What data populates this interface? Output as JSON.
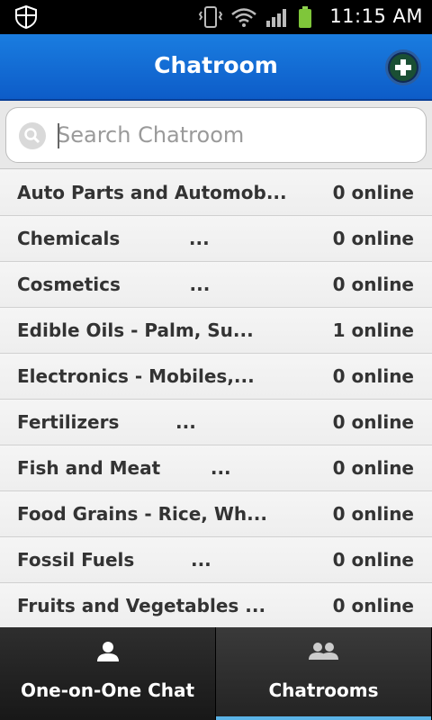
{
  "status_bar": {
    "time": "11:15 AM"
  },
  "header": {
    "title": "Chatroom"
  },
  "search": {
    "placeholder": "Search Chatroom",
    "value": ""
  },
  "chatrooms": [
    {
      "name": "Auto Parts and Automob...",
      "online": "0 online"
    },
    {
      "name": "Chemicals           ...",
      "online": "0 online"
    },
    {
      "name": "Cosmetics           ...",
      "online": "0 online"
    },
    {
      "name": "Edible Oils - Palm, Su...",
      "online": "1 online"
    },
    {
      "name": "Electronics - Mobiles,...",
      "online": "0 online"
    },
    {
      "name": "Fertilizers         ...",
      "online": "0 online"
    },
    {
      "name": "Fish and Meat        ...",
      "online": "0 online"
    },
    {
      "name": "Food Grains - Rice, Wh...",
      "online": "0 online"
    },
    {
      "name": "Fossil Fuels         ...",
      "online": "0 online"
    },
    {
      "name": "Fruits and Vegetables ...",
      "online": "0 online"
    }
  ],
  "tabs": [
    {
      "label": "One-on-One Chat",
      "icon": "person-icon",
      "active": false
    },
    {
      "label": "Chatrooms",
      "icon": "group-icon",
      "active": true
    }
  ],
  "colors": {
    "header_blue": "#1a7de0",
    "tab_indicator": "#5ab3e6"
  }
}
